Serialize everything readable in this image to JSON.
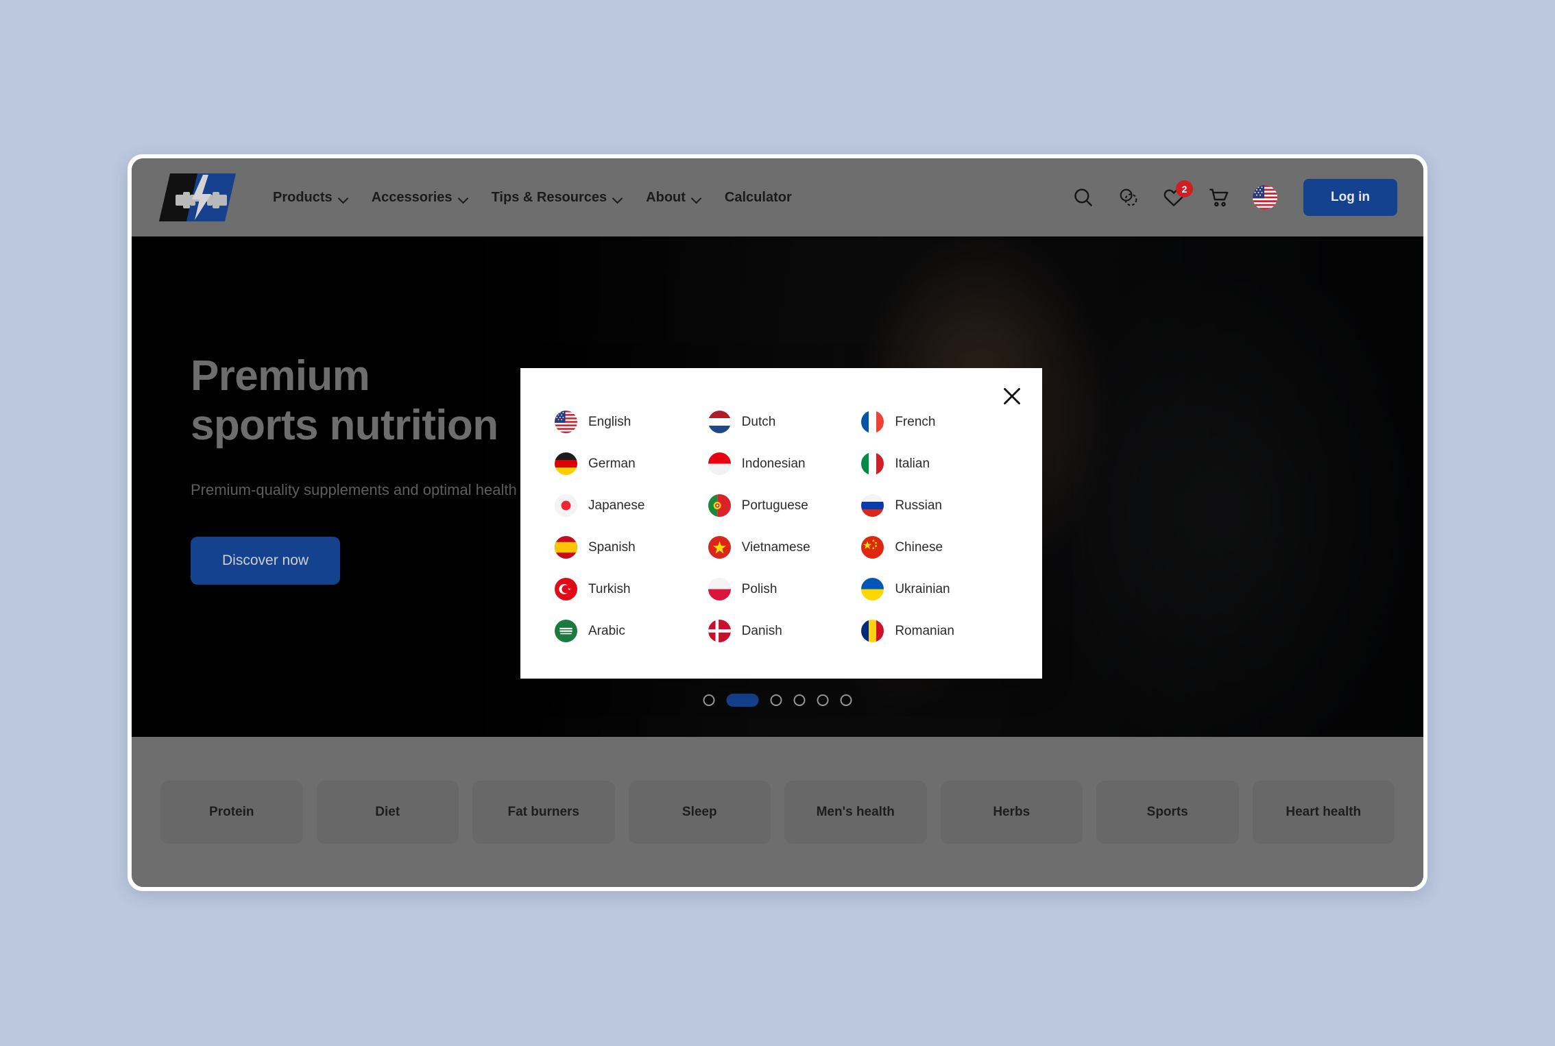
{
  "brand": {
    "logo_name": "barbell-lightning-logo"
  },
  "nav": {
    "items": [
      {
        "label": "Products",
        "has_dropdown": true
      },
      {
        "label": "Accessories",
        "has_dropdown": true
      },
      {
        "label": "Tips & Resources",
        "has_dropdown": true
      },
      {
        "label": "About",
        "has_dropdown": true
      },
      {
        "label": "Calculator",
        "has_dropdown": false
      }
    ]
  },
  "header_actions": {
    "search_icon": "search-icon",
    "compare_icon": "compare-icon",
    "wishlist_icon": "heart-icon",
    "wishlist_count": "2",
    "cart_icon": "cart-icon",
    "language_flag": "us-flag-icon",
    "login_label": "Log in"
  },
  "hero": {
    "title": "Premium\nsports nutrition",
    "subtitle": "Premium-quality supplements and optimal health",
    "cta_label": "Discover now",
    "carousel": {
      "total": 6,
      "active_index": 1
    }
  },
  "categories": [
    "Protein",
    "Diet",
    "Fat burners",
    "Sleep",
    "Men's health",
    "Herbs",
    "Sports",
    "Heart health"
  ],
  "language_modal": {
    "close_icon": "close-icon",
    "languages": [
      {
        "label": "English",
        "flag": "us-flag"
      },
      {
        "label": "Dutch",
        "flag": "nl-flag"
      },
      {
        "label": "French",
        "flag": "fr-flag"
      },
      {
        "label": "German",
        "flag": "de-flag"
      },
      {
        "label": "Indonesian",
        "flag": "id-flag"
      },
      {
        "label": "Italian",
        "flag": "it-flag"
      },
      {
        "label": "Japanese",
        "flag": "jp-flag"
      },
      {
        "label": "Portuguese",
        "flag": "pt-flag"
      },
      {
        "label": "Russian",
        "flag": "ru-flag"
      },
      {
        "label": "Spanish",
        "flag": "es-flag"
      },
      {
        "label": "Vietnamese",
        "flag": "vn-flag"
      },
      {
        "label": "Chinese",
        "flag": "cn-flag"
      },
      {
        "label": "Turkish",
        "flag": "tr-flag"
      },
      {
        "label": "Polish",
        "flag": "pl-flag"
      },
      {
        "label": "Ukrainian",
        "flag": "ua-flag"
      },
      {
        "label": "Arabic",
        "flag": "sa-flag"
      },
      {
        "label": "Danish",
        "flag": "dk-flag"
      },
      {
        "label": "Romanian",
        "flag": "ro-flag"
      }
    ]
  },
  "colors": {
    "page_background": "#bcc8de",
    "brand_blue": "#14428f",
    "badge_red": "#cf1f22",
    "header_gray": "#6e6e6e",
    "modal_white": "#ffffff"
  }
}
